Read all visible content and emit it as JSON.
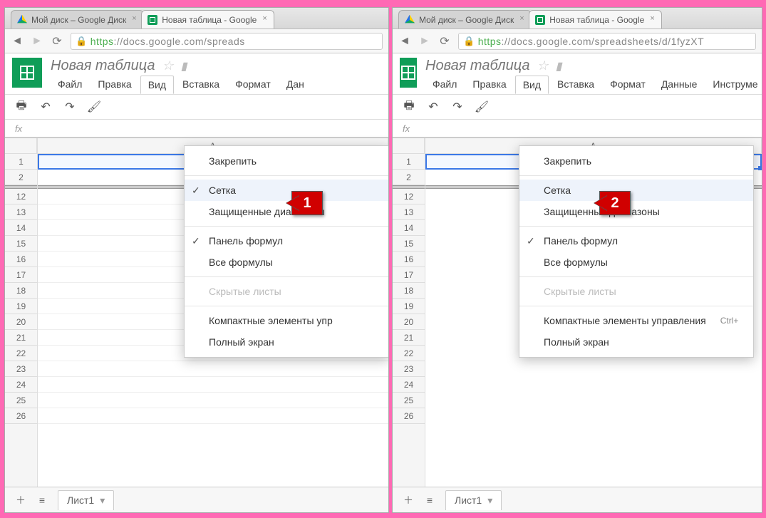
{
  "browser_tabs": {
    "drive": "Мой диск – Google Диск",
    "sheets": "Новая таблица - Google"
  },
  "url": {
    "scheme": "https",
    "left_rest": "://docs.google.com/spreads",
    "right_rest": "://docs.google.com/spreadsheets/d/1fyzXT"
  },
  "doc_title": "Новая таблица",
  "menus": {
    "file": "Файл",
    "edit": "Правка",
    "view": "Вид",
    "insert": "Вставка",
    "format": "Формат",
    "data_short": "Дан",
    "data": "Данные",
    "tools": "Инструме"
  },
  "fx_label": "fx",
  "col_a": "A",
  "rows_left": [
    "1",
    "2",
    "12",
    "13",
    "14",
    "15",
    "16",
    "17",
    "18",
    "19",
    "20",
    "21",
    "22",
    "23",
    "24",
    "25",
    "26"
  ],
  "rows_right": [
    "1",
    "2",
    "12",
    "13",
    "14",
    "15",
    "16",
    "17",
    "18",
    "19",
    "20",
    "21",
    "22",
    "23",
    "24",
    "25",
    "26"
  ],
  "view_menu": {
    "freeze": "Закрепить",
    "grid": "Сетка",
    "protected": "Защищенные диапазоны",
    "formula_bar": "Панель формул",
    "all_formulas": "Все формулы",
    "hidden_sheets": "Скрытые листы",
    "compact": "Компактные элементы упр",
    "compact_full": "Компактные элементы управления",
    "compact_accel": "Ctrl+",
    "fullscreen": "Полный экран"
  },
  "callout1": "1",
  "callout2": "2",
  "sheet_tab": "Лист1"
}
